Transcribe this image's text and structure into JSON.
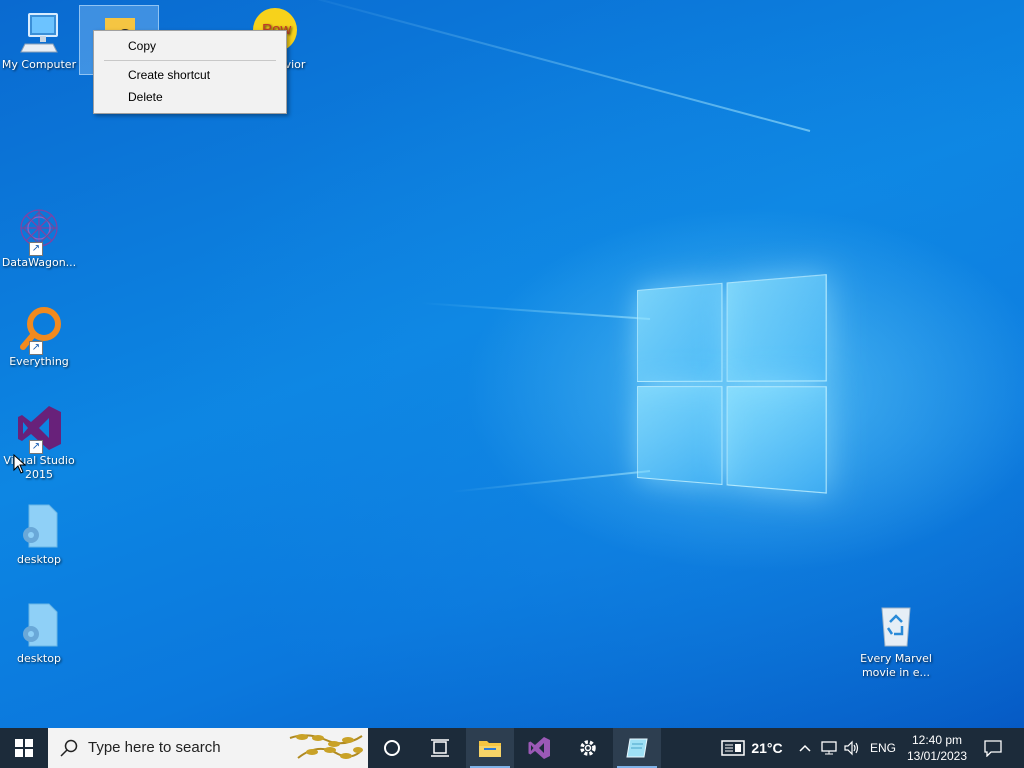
{
  "desktop_icons": [
    {
      "label": "My Computer",
      "icon": "computer-icon"
    },
    {
      "label": "",
      "icon": "user-folder-icon"
    },
    {
      "label": "vior",
      "icon": "powershell-icon"
    },
    {
      "label": "DataWagon...",
      "icon": "datawagon-icon"
    },
    {
      "label": "Everything",
      "icon": "everything-search-icon"
    },
    {
      "label": "Visual Studio 2015",
      "icon": "visual-studio-icon"
    },
    {
      "label": "desktop",
      "icon": "config-file-icon"
    },
    {
      "label": "desktop",
      "icon": "config-file-icon"
    },
    {
      "label": "Every Marvel movie in e...",
      "icon": "recycle-bin-icon"
    }
  ],
  "powershell_partial_text": "Pow",
  "context_menu": {
    "items": [
      "Copy",
      "Create shortcut",
      "Delete"
    ]
  },
  "taskbar": {
    "search_placeholder": "Type here to search",
    "apps": [
      {
        "name": "cortana-icon"
      },
      {
        "name": "task-view-icon"
      },
      {
        "name": "file-explorer-icon"
      },
      {
        "name": "visual-studio-icon"
      },
      {
        "name": "settings-icon"
      },
      {
        "name": "notepad-app-icon"
      }
    ],
    "weather": "21°C",
    "language": "ENG",
    "time": "12:40 pm",
    "date": "13/01/2023"
  },
  "colors": {
    "desktop_blue": "#0d86e3",
    "taskbar": "#1c2b3a",
    "vs_purple": "#68217a",
    "everything_orange": "#f28a1e"
  }
}
